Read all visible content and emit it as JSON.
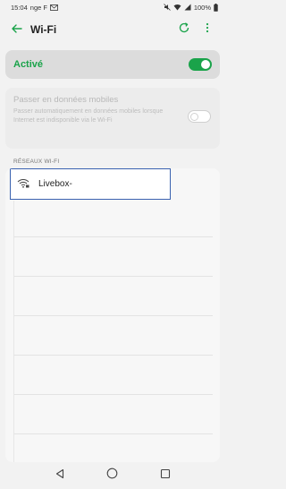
{
  "status_bar": {
    "time": "15:04",
    "carrier": "nge F",
    "battery": "100%",
    "icons": [
      "mail-icon",
      "mute-icon",
      "wifi-signal-icon",
      "battery-icon"
    ]
  },
  "header": {
    "title": "Wi-Fi",
    "back_icon": "arrow-left-icon",
    "refresh_icon": "refresh-icon",
    "menu_icon": "more-vertical-icon"
  },
  "wifi_toggle": {
    "label": "Activé",
    "state": "on"
  },
  "mobile_data": {
    "title": "Passer en données mobiles",
    "description": "Passer automatiquement en données mobiles lorsque Internet est indisponible via le Wi-Fi",
    "state": "off"
  },
  "networks": {
    "section_label": "RÉSEAUX WI-FI",
    "items": [
      {
        "name": "Livebox-",
        "icon": "wifi-secured-icon"
      }
    ]
  },
  "nav_bar": {
    "back": "back-triangle-icon",
    "home": "home-circle-icon",
    "recents": "recents-square-icon"
  },
  "colors": {
    "accent": "#1aa34a",
    "highlight_border": "#3a62b0",
    "background": "#f2f2f2"
  }
}
